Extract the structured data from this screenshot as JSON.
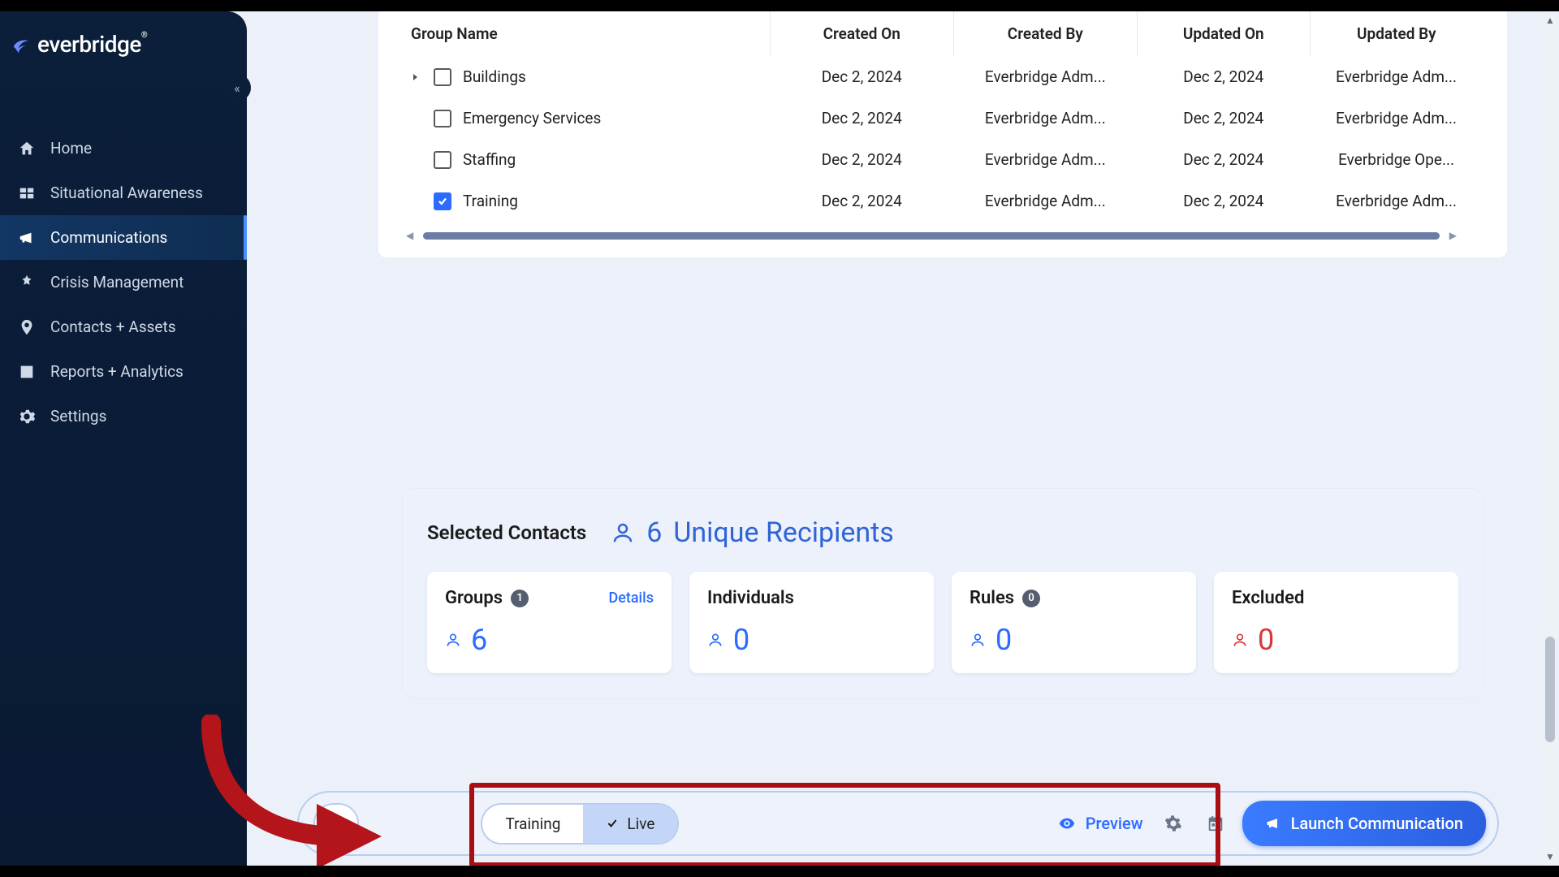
{
  "brand": {
    "name": "everbridge"
  },
  "sidebar": {
    "items": [
      {
        "label": "Home",
        "icon": "home"
      },
      {
        "label": "Situational Awareness",
        "icon": "situational"
      },
      {
        "label": "Communications",
        "icon": "megaphone",
        "active": true
      },
      {
        "label": "Crisis Management",
        "icon": "crisis"
      },
      {
        "label": "Contacts + Assets",
        "icon": "pin"
      },
      {
        "label": "Reports + Analytics",
        "icon": "chart"
      },
      {
        "label": "Settings",
        "icon": "gear"
      }
    ]
  },
  "table": {
    "headers": {
      "name": "Group Name",
      "createdOn": "Created On",
      "createdBy": "Created By",
      "updatedOn": "Updated On",
      "updatedBy": "Updated By"
    },
    "rows": [
      {
        "name": "Buildings",
        "createdOn": "Dec 2, 2024",
        "createdBy": "Everbridge Adm...",
        "updatedOn": "Dec 2, 2024",
        "updatedBy": "Everbridge Adm...",
        "expandable": true,
        "checked": false
      },
      {
        "name": "Emergency Services",
        "createdOn": "Dec 2, 2024",
        "createdBy": "Everbridge Adm...",
        "updatedOn": "Dec 2, 2024",
        "updatedBy": "Everbridge Adm...",
        "expandable": false,
        "checked": false
      },
      {
        "name": "Staffing",
        "createdOn": "Dec 2, 2024",
        "createdBy": "Everbridge Adm...",
        "updatedOn": "Dec 2, 2024",
        "updatedBy": "Everbridge Ope...",
        "expandable": false,
        "checked": false
      },
      {
        "name": "Training",
        "createdOn": "Dec 2, 2024",
        "createdBy": "Everbridge Adm...",
        "updatedOn": "Dec 2, 2024",
        "updatedBy": "Everbridge Adm...",
        "expandable": false,
        "checked": true
      }
    ]
  },
  "selected": {
    "title": "Selected Contacts",
    "recipientsCount": "6",
    "recipientsLabel": "Unique Recipients",
    "cards": {
      "groups": {
        "label": "Groups",
        "badge": "1",
        "details": "Details",
        "value": "6"
      },
      "individuals": {
        "label": "Individuals",
        "value": "0"
      },
      "rules": {
        "label": "Rules",
        "badge": "0",
        "value": "0"
      },
      "excluded": {
        "label": "Excluded",
        "value": "0"
      }
    }
  },
  "footer": {
    "modeA": "Training",
    "modeB": "Live",
    "preview": "Preview",
    "launch": "Launch Communication"
  }
}
